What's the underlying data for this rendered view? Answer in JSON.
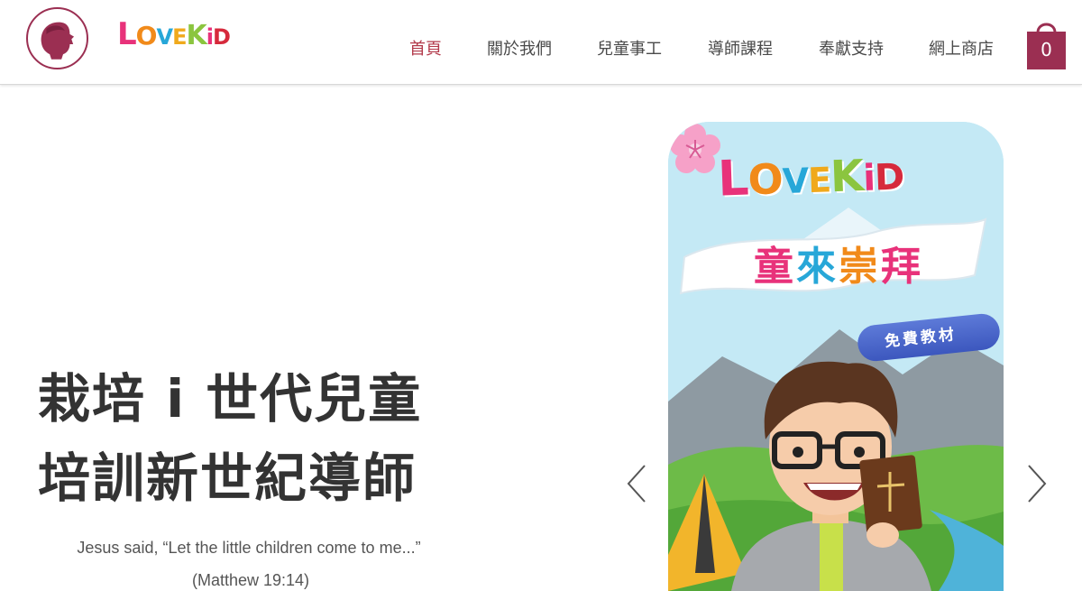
{
  "header": {
    "brand_wordmark": [
      "L",
      "O",
      "V",
      "E",
      "K",
      "i",
      "D"
    ],
    "nav": [
      {
        "label": "首頁",
        "active": true
      },
      {
        "label": "關於我們",
        "active": false
      },
      {
        "label": "兒童事工",
        "active": false
      },
      {
        "label": "導師課程",
        "active": false
      },
      {
        "label": "奉獻支持",
        "active": false
      },
      {
        "label": "網上商店",
        "active": false
      }
    ],
    "cart_count": "0"
  },
  "hero": {
    "title_line1": "栽培 i 世代兒童",
    "title_line2": "培訓新世紀導師",
    "quote": "Jesus said, “Let the little children come to me...”",
    "quote_ref": "(Matthew 19:14)"
  },
  "slider": {
    "slide_brand": [
      "L",
      "O",
      "V",
      "E",
      "K",
      "i",
      "D"
    ],
    "slide_subtitle": [
      "童",
      "來",
      "崇",
      "拜"
    ],
    "badge_text": "免費教材"
  },
  "colors": {
    "brand": "#9b2f52",
    "active_nav": "#b2394a",
    "text": "#333333",
    "slide_sky": "#bfe7f4",
    "badge": "#4663c9"
  },
  "icons": {
    "logo": "child-silhouette-logo-icon",
    "cart": "shopping-bag-icon",
    "prev": "chevron-left-icon",
    "next": "chevron-right-icon"
  }
}
